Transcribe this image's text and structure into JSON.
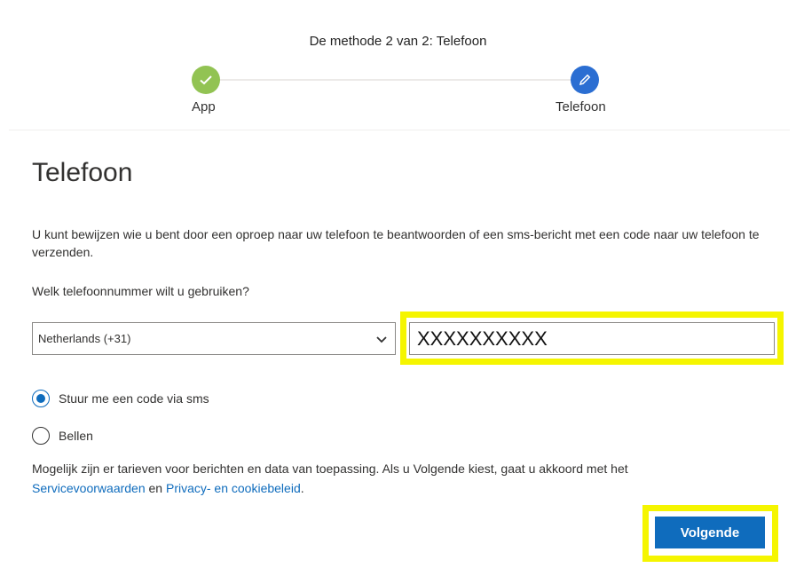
{
  "header": {
    "title": "De methode 2 van 2: Telefoon"
  },
  "progress": {
    "steps": [
      {
        "label": "App",
        "status": "done",
        "icon": "checkmark-icon"
      },
      {
        "label": "Telefoon",
        "status": "active",
        "icon": "pencil-icon"
      }
    ]
  },
  "main": {
    "title": "Telefoon",
    "description": "U kunt bewijzen wie u bent door een oproep naar uw telefoon te beantwoorden of een sms-bericht met een code naar uw telefoon te verzenden.",
    "question": "Welk telefoonnummer wilt u gebruiken?",
    "country_select": {
      "value": "Netherlands (+31)"
    },
    "phone_input": {
      "value": "XXXXXXXXXX"
    },
    "options": [
      {
        "label": "Stuur me een code via sms",
        "checked": true
      },
      {
        "label": "Bellen",
        "checked": false
      }
    ],
    "terms": {
      "text": "Mogelijk zijn er tarieven voor berichten en data van toepassing. Als u Volgende kiest, gaat u akkoord met het",
      "link1": "Servicevoorwaarden",
      "conjunction": "en",
      "link2": "Privacy- en cookiebeleid",
      "end": "."
    },
    "next_label": "Volgende"
  },
  "colors": {
    "accent": "#0f6cbd",
    "step_done": "#92c353",
    "step_active": "#2b6ed2",
    "highlight": "#f5f500"
  }
}
